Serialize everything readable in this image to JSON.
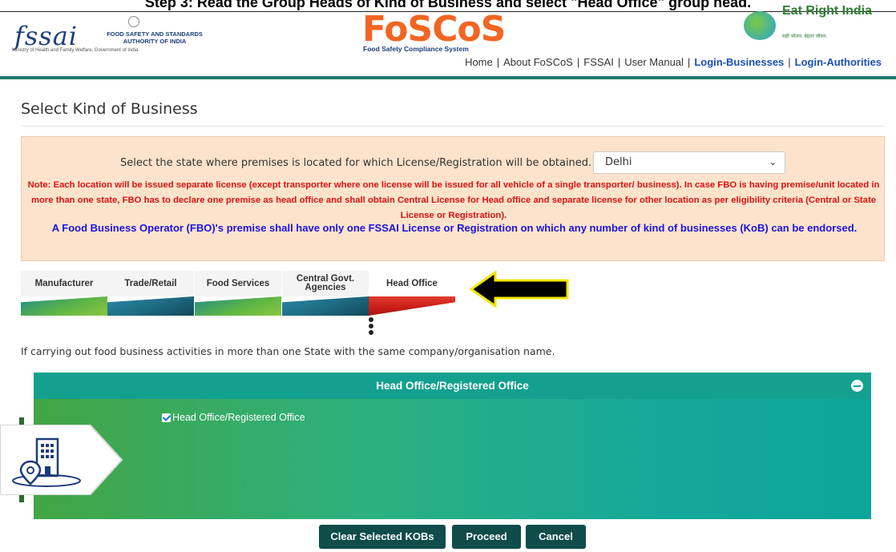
{
  "step_title": "Step 3: Read the Group Heads of Kind of Business and select \"Head Office\" group head.",
  "header": {
    "fssai_logo_text": "fssai",
    "fssai_authority": "FOOD SAFETY AND STANDARDS AUTHORITY OF INDIA",
    "fssai_ministry": "Ministry of Health and Family Welfare, Government of India",
    "foscos_logo_text": "FoSCoS",
    "foscos_subtitle": "Food Safety Compliance System",
    "eatright_title": "Eat Right India",
    "eatright_tagline": "सही भोजन. बेहतर जीवन.",
    "nav": [
      {
        "label": "Home"
      },
      {
        "label": "About FoSCoS"
      },
      {
        "label": "FSSAI"
      },
      {
        "label": "User Manual"
      },
      {
        "label": "Login-Businesses"
      },
      {
        "label": "Login-Authorities"
      }
    ]
  },
  "page_heading": "Select Kind of Business",
  "notice": {
    "state_label": "Select the state where premises is located for which License/Registration will be obtained.",
    "state_value": "Delhi",
    "note_red": "Note: Each location will be issued separate license (except transporter where one license will be issued for all vehicle of a single transporter/ business). In case FBO is having premise/unit located in more than one state, FBO has to declare one premise as head office and shall obtain Central License for Head office and separate license for other location as per eligibility criteria (Central or State License or Registration).",
    "note_blue": "A Food Business Operator (FBO)'s premise shall have only one FSSAI License or Registration on which any number of kind of businesses (KoB) can be endorsed."
  },
  "tabs": [
    {
      "label": "Manufacturer"
    },
    {
      "label": "Trade/Retail"
    },
    {
      "label": "Food Services"
    },
    {
      "label": "Central Govt. Agencies"
    },
    {
      "label": "Head Office"
    }
  ],
  "multi_state_text": "If carrying out food business activities in more than one State with the same company/organisation name.",
  "accordion": {
    "title": "Head Office/Registered Office",
    "checkbox_label": "Head Office/Registered Office",
    "checked": true
  },
  "buttons": {
    "clear": "Clear Selected KOBs",
    "proceed": "Proceed",
    "cancel": "Cancel"
  },
  "colors": {
    "accent_teal": "#14a08f",
    "button_dark": "#0f4c4a",
    "note_red": "#d9130f",
    "note_blue": "#1a14e0",
    "notice_bg": "#fde3cc"
  },
  "icons": [
    "minus-circle-icon",
    "building-location-icon",
    "arrow-left-icon",
    "chevron-down-icon"
  ]
}
